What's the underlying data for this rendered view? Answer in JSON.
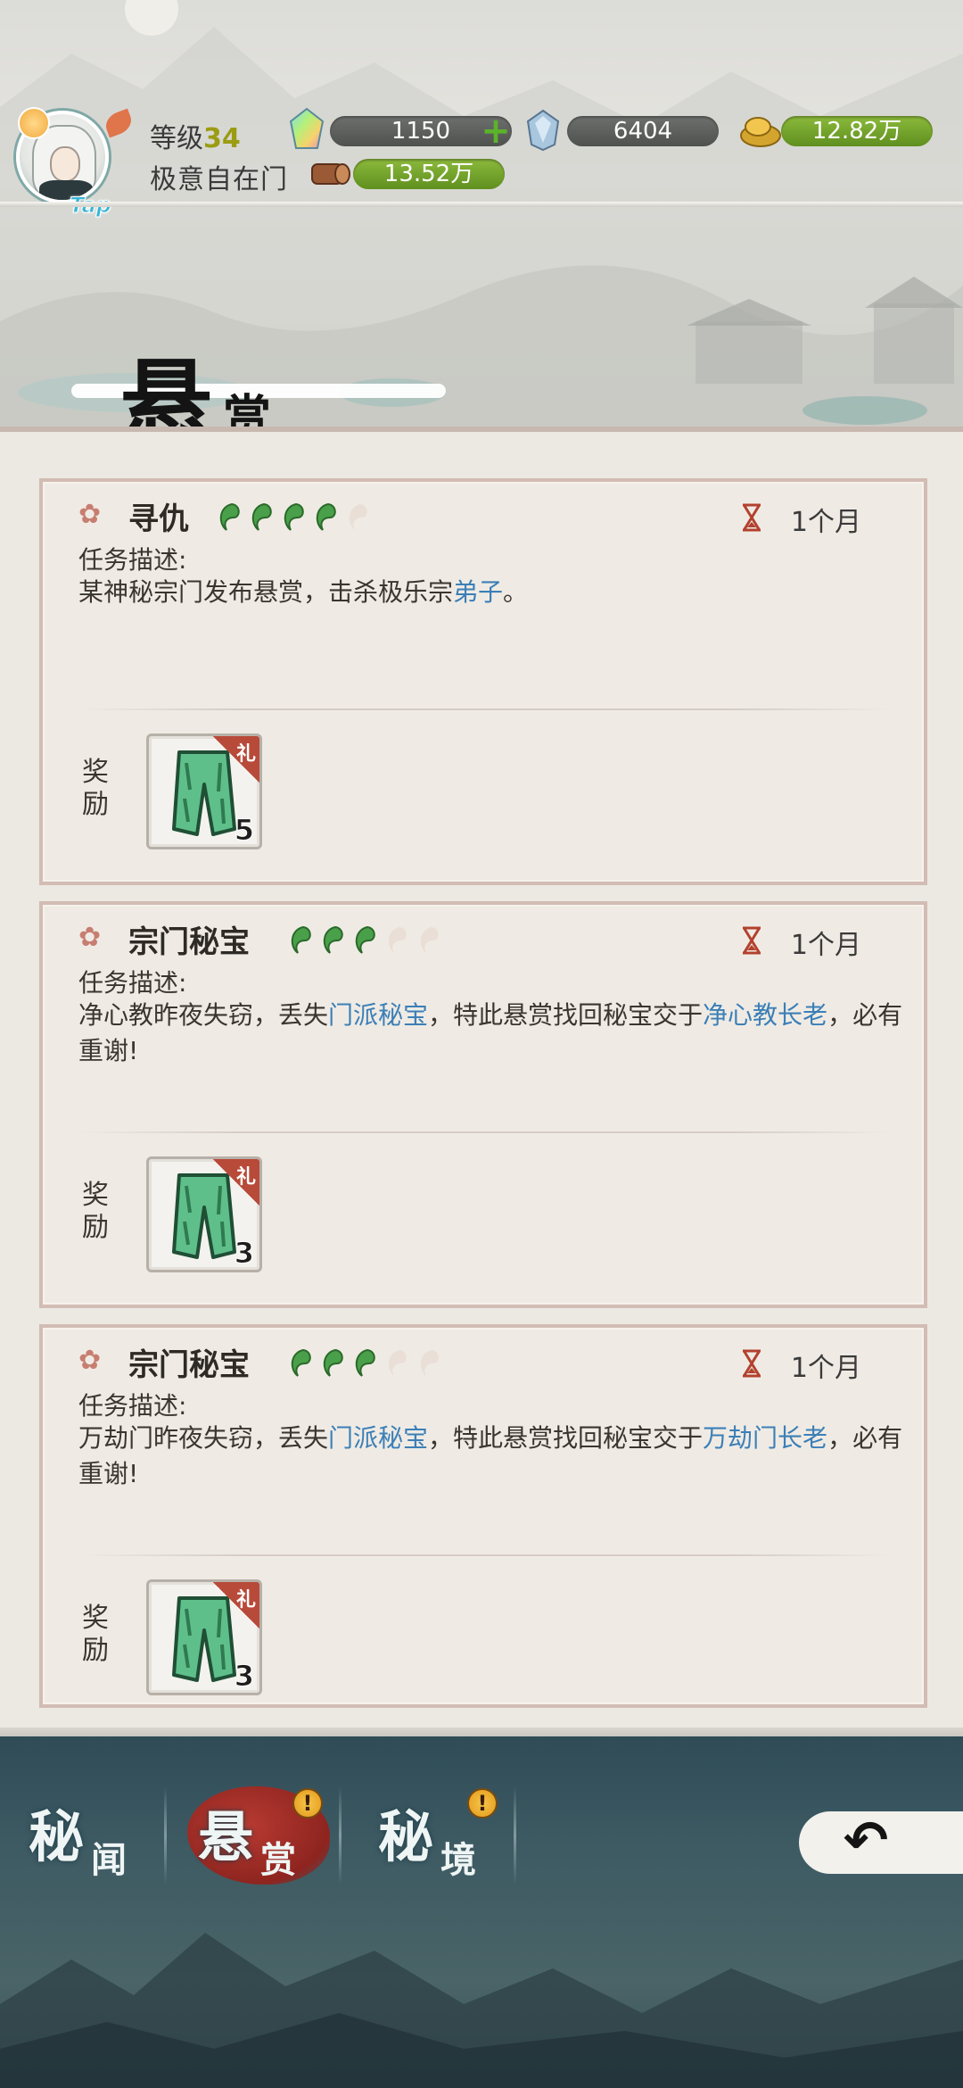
{
  "player": {
    "level_label": "等级",
    "level_value": "34",
    "sect_name": "极意自在门",
    "tap_label": "Tap"
  },
  "resources": {
    "spirit_crystal": "1150",
    "diamond": "6404",
    "gold": "12.82万",
    "wood": "13.52万"
  },
  "heading": {
    "big": "悬",
    "small": "赏"
  },
  "quests": [
    {
      "title": "寻仇",
      "filled_beads": 4,
      "total_beads": 5,
      "duration": "1个月",
      "desc_label": "任务描述:",
      "desc_parts": [
        "某神秘宗门发布悬赏，击杀极乐宗",
        "弟子",
        "。"
      ],
      "reward_label_1": "奖",
      "reward_label_2": "励",
      "reward_tag": "礼",
      "reward_count": "5"
    },
    {
      "title": "宗门秘宝",
      "filled_beads": 3,
      "total_beads": 5,
      "duration": "1个月",
      "desc_label": "任务描述:",
      "desc_parts": [
        "净心教昨夜失窃，丢失",
        "门派秘宝",
        "，特此悬赏找回秘宝交于",
        "净心教长老",
        "，必有重谢!"
      ],
      "reward_label_1": "奖",
      "reward_label_2": "励",
      "reward_tag": "礼",
      "reward_count": "3"
    },
    {
      "title": "宗门秘宝",
      "filled_beads": 3,
      "total_beads": 5,
      "duration": "1个月",
      "desc_label": "任务描述:",
      "desc_parts": [
        "万劫门昨夜失窃，丢失",
        "门派秘宝",
        "，特此悬赏找回秘宝交于",
        "万劫门长老",
        "，必有重谢!"
      ],
      "reward_label_1": "奖",
      "reward_label_2": "励",
      "reward_tag": "礼",
      "reward_count": "3"
    }
  ],
  "nav": {
    "tab1_big": "秘",
    "tab1_small": "闻",
    "tab2_big": "悬",
    "tab2_small": "赏",
    "tab3_big": "秘",
    "tab3_small": "境",
    "alert_glyph": "!",
    "back_glyph": "↶"
  },
  "colors": {
    "highlight_text": "#3c7fb7",
    "bead_filled": "#4aa04a",
    "bead_empty": "#eadfd6",
    "active_tab": "#a5302a"
  }
}
